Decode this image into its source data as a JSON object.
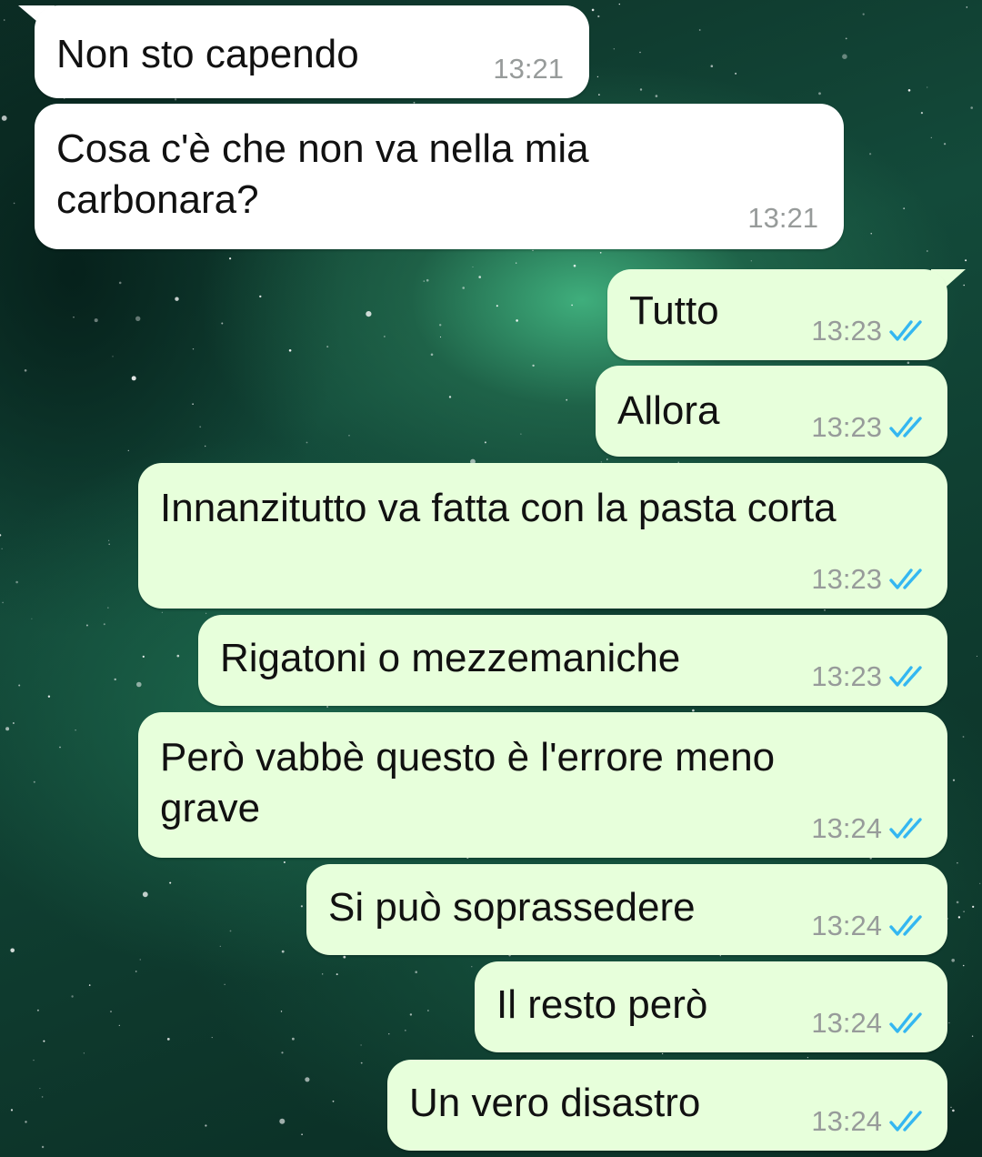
{
  "colors": {
    "incoming_bubble": "#ffffff",
    "outgoing_bubble": "#e7ffdb",
    "timestamp": "#979b9a",
    "read_ticks": "#34b7f1",
    "wallpaper": "#134a3a"
  },
  "icons": {
    "read_receipt": "double-check-icon"
  },
  "messages": [
    {
      "direction": "in",
      "text": "Non sto capendo",
      "time": "13:21"
    },
    {
      "direction": "in",
      "text": "Cosa c'è che non va nella mia\ncarbonara?",
      "time": "13:21"
    },
    {
      "direction": "out",
      "text": "Tutto",
      "time": "13:23",
      "status": "read"
    },
    {
      "direction": "out",
      "text": "Allora",
      "time": "13:23",
      "status": "read"
    },
    {
      "direction": "out",
      "text": "Innanzitutto va fatta con la pasta corta",
      "time": "13:23",
      "status": "read"
    },
    {
      "direction": "out",
      "text": "Rigatoni o mezzemaniche",
      "time": "13:23",
      "status": "read"
    },
    {
      "direction": "out",
      "text": "Però vabbè questo è l'errore meno\ngrave",
      "time": "13:24",
      "status": "read"
    },
    {
      "direction": "out",
      "text": "Si può soprassedere",
      "time": "13:24",
      "status": "read"
    },
    {
      "direction": "out",
      "text": "Il resto però",
      "time": "13:24",
      "status": "read"
    },
    {
      "direction": "out",
      "text": "Un vero disastro",
      "time": "13:24",
      "status": "read"
    }
  ]
}
